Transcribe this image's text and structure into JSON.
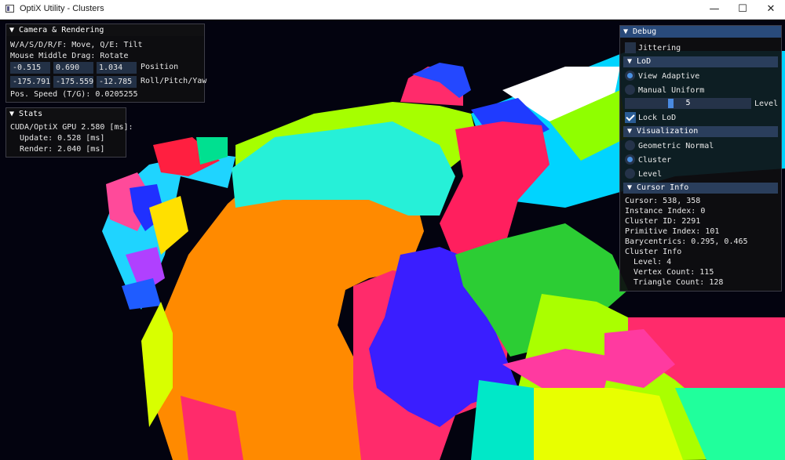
{
  "window": {
    "title": "OptiX Utility - Clusters",
    "minimize_icon": "minimize-icon",
    "maximize_icon": "maximize-icon",
    "close_icon": "close-icon"
  },
  "camera": {
    "header": "▼ Camera & Rendering",
    "help_move": "W/A/S/D/R/F: Move, Q/E: Tilt",
    "help_rotate": "Mouse Middle Drag: Rotate",
    "position": [
      "-0.515",
      "0.690",
      "1.034"
    ],
    "position_label": "Position",
    "rotation": [
      "-175.791",
      "-175.559",
      "-12.785"
    ],
    "rotation_label": "Roll/Pitch/Yaw",
    "speed": "Pos. Speed (T/G): 0.0205255"
  },
  "stats": {
    "header": "▼ Stats",
    "gpu": "CUDA/OptiX GPU 2.580 [ms]:",
    "update": "Update: 0.528 [ms]",
    "render": "Render: 2.040 [ms]"
  },
  "debug": {
    "header": "▼ Debug",
    "jittering_label": "Jittering",
    "jittering": false,
    "lod_header": "▼ LoD",
    "lod_modes": [
      {
        "label": "View Adaptive",
        "selected": true
      },
      {
        "label": "Manual Uniform",
        "selected": false
      }
    ],
    "level_value": "5",
    "level_fraction": 0.357,
    "level_label": "Level",
    "lock_lod_label": "Lock LoD",
    "lock_lod": true,
    "vis_header": "▼ Visualization",
    "vis_modes": [
      {
        "label": "Geometric Normal",
        "selected": false
      },
      {
        "label": "Cluster",
        "selected": true
      },
      {
        "label": "Level",
        "selected": false
      }
    ],
    "cursor_header": "▼ Cursor Info",
    "cursor": "Cursor: 538, 358",
    "instance": "Instance Index: 0",
    "cluster_id": "Cluster ID: 2291",
    "primitive": "Primitive Index: 101",
    "bary": "Barycentrics: 0.295, 0.465",
    "cluster_info": "Cluster Info",
    "level": "Level: 4",
    "vertex_count": "Vertex Count: 115",
    "triangle_count": "Triangle Count: 128"
  },
  "colors": {
    "panel_title": "#294a7a",
    "section": "#2a3e5c",
    "field": "#233146",
    "accent": "#4a90e0"
  }
}
